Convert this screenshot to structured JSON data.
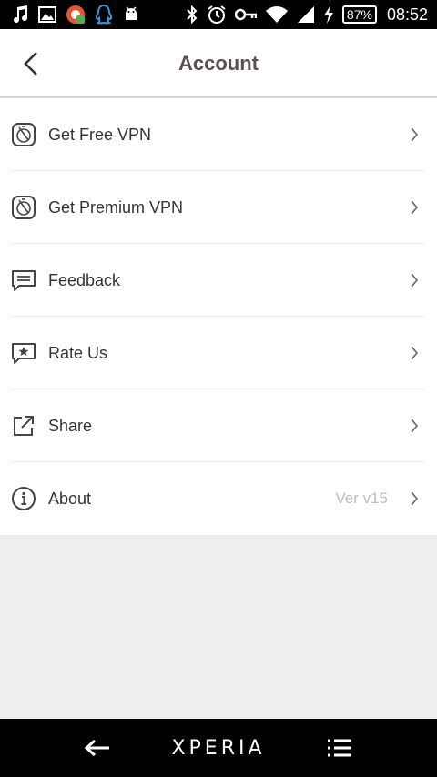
{
  "status_bar": {
    "battery_percent": "87%",
    "time": "08:52",
    "left_icons": [
      "music-note-icon",
      "image-icon",
      "app-badge-icon",
      "qq-penguin-icon",
      "android-icon"
    ],
    "right_icons": [
      "bluetooth-icon",
      "alarm-clock-icon",
      "vpn-key-icon",
      "wifi-icon",
      "signal-icon",
      "charging-icon"
    ]
  },
  "header": {
    "title": "Account"
  },
  "menu": [
    {
      "label": "Get Free VPN",
      "icon": "vpn-timer-icon",
      "value": ""
    },
    {
      "label": "Get Premium VPN",
      "icon": "vpn-timer-icon",
      "value": ""
    },
    {
      "label": "Feedback",
      "icon": "feedback-icon",
      "value": ""
    },
    {
      "label": "Rate Us",
      "icon": "rate-star-icon",
      "value": ""
    },
    {
      "label": "Share",
      "icon": "share-icon",
      "value": ""
    },
    {
      "label": "About",
      "icon": "info-icon",
      "value": "Ver v15"
    }
  ],
  "nav_bar": {
    "brand": "XPERIA"
  },
  "colors": {
    "title": "#5a4e4e",
    "item_text": "#333333",
    "version_text": "#bdbdbd",
    "background": "#eeeeee"
  }
}
